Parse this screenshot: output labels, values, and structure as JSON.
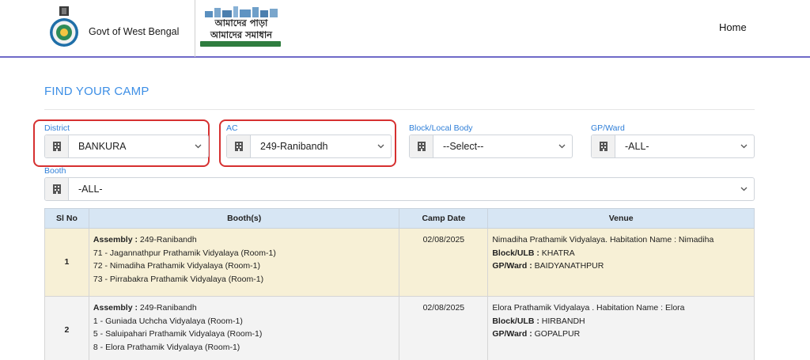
{
  "header": {
    "govt_name": "Govt of West Bengal",
    "logo_line1": "আমাদের পাড়া",
    "logo_line2": "আমাদের সমাধান",
    "nav_home": "Home"
  },
  "page_title": "FIND YOUR CAMP",
  "filters": {
    "district": {
      "label": "District",
      "value": "BANKURA"
    },
    "ac": {
      "label": "AC",
      "value": "249-Ranibandh"
    },
    "block": {
      "label": "Block/Local Body",
      "value": "--Select--"
    },
    "gp": {
      "label": "GP/Ward",
      "value": "-ALL-"
    },
    "booth": {
      "label": "Booth",
      "value": "-ALL-"
    }
  },
  "table": {
    "headers": [
      "Sl No",
      "Booth(s)",
      "Camp Date",
      "Venue"
    ],
    "assembly_label": "Assembly :",
    "block_label": "Block/ULB :",
    "gp_label": "GP/Ward :",
    "rows": [
      {
        "sl": "1",
        "assembly": "249-Ranibandh",
        "booths": [
          "71 - Jagannathpur Prathamik Vidyalaya (Room-1)",
          "72 - Nimadiha Prathamik Vidyalaya (Room-1)",
          "73 - Pirrabakra Prathamik Vidyalaya (Room-1)"
        ],
        "camp_date": "02/08/2025",
        "venue": "Nimadiha Prathamik Vidyalaya. Habitation Name : Nimadiha",
        "block_ulb": "KHATRA",
        "gp_ward": "BAIDYANATHPUR"
      },
      {
        "sl": "2",
        "assembly": "249-Ranibandh",
        "booths": [
          "1 - Guniada Uchcha Vidyalaya (Room-1)",
          "5 - Saluipahari Prathamik Vidyalaya (Room-1)",
          "8 - Elora Prathamik Vidyalaya (Room-1)"
        ],
        "camp_date": "02/08/2025",
        "venue": "Elora Prathamik Vidyalaya . Habitation Name : Elora",
        "block_ulb": "HIRBANDH",
        "gp_ward": "GOPALPUR"
      }
    ]
  },
  "colors": {
    "accent_blue": "#3d8fe6",
    "highlight_red": "#d63030",
    "header_rule": "#6f6ac8",
    "row_highlight": "#f7f0d6"
  },
  "icons": {
    "emblem": "west-bengal-emblem-icon",
    "select_addon": "building-icon",
    "dropdown": "chevron-down-icon"
  }
}
